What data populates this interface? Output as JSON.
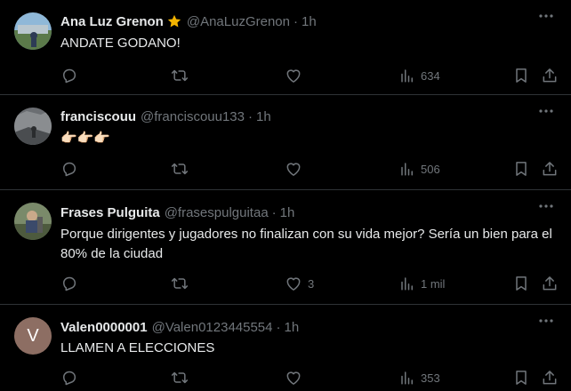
{
  "tweets": [
    {
      "name": "Ana Luz Grenon",
      "verified": true,
      "handle": "@AnaLuzGrenon",
      "time": "1h",
      "text": "ANDATE GODANO!",
      "likes": "",
      "views": "634"
    },
    {
      "name": "franciscouu",
      "verified": false,
      "handle": "@franciscouu133",
      "time": "1h",
      "text": "👉🏻👉🏻👉🏻",
      "likes": "",
      "views": "506"
    },
    {
      "name": "Frases Pulguita",
      "verified": false,
      "handle": "@frasespulguitaa",
      "time": "1h",
      "text": "Porque dirigentes y jugadores no finalizan con su vida mejor? Sería un bien para el 80% de la ciudad",
      "likes": "3",
      "views": "1 mil"
    },
    {
      "name": "Valen0000001",
      "verified": false,
      "handle": "@Valen0123445554",
      "time": "1h",
      "text": "LLAMEN A ELECCIONES",
      "likes": "",
      "views": "353",
      "avatar_letter": "V"
    }
  ],
  "separator": "·",
  "colors": {
    "background": "#000000",
    "text": "#e7e9ea",
    "muted": "#71767b",
    "border": "#2f3336",
    "verified": "#f4b400"
  },
  "icons": [
    "reply-icon",
    "retweet-icon",
    "like-icon",
    "views-icon",
    "bookmark-icon",
    "share-icon",
    "more-icon",
    "verified-star-icon"
  ]
}
